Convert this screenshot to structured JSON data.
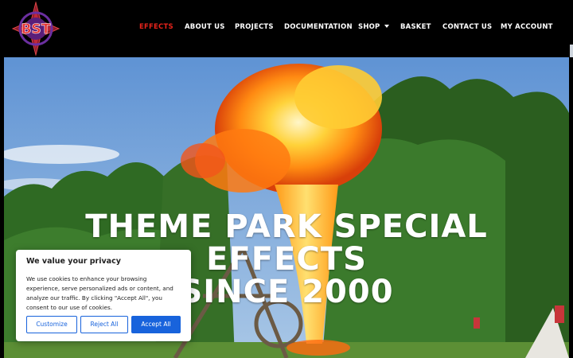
{
  "brand": {
    "logo_text": "BST"
  },
  "nav": {
    "items": [
      {
        "label": "EFFECTS",
        "active": true
      },
      {
        "label": "ABOUT US"
      },
      {
        "label": "PROJECTS"
      },
      {
        "label": "DOCUMENTATION"
      },
      {
        "label": "SHOP"
      },
      {
        "label": "BASKET"
      },
      {
        "label": "CONTACT US"
      },
      {
        "label": "MY ACCOUNT"
      }
    ]
  },
  "hero": {
    "title_line1": "THEME PARK SPECIAL EFFECTS",
    "title_line2": "SINCE 2000"
  },
  "cookie": {
    "title": "We value your privacy",
    "text": "We use cookies to enhance your browsing experience, serve personalized ads or content, and analyze our traffic. By clicking \"Accept All\", you consent to our use of cookies.",
    "customize_label": "Customize",
    "reject_label": "Reject All",
    "accept_label": "Accept All"
  },
  "colors": {
    "active_nav": "#e8231b",
    "accent": "#1863dc",
    "header_bg": "#000000"
  }
}
